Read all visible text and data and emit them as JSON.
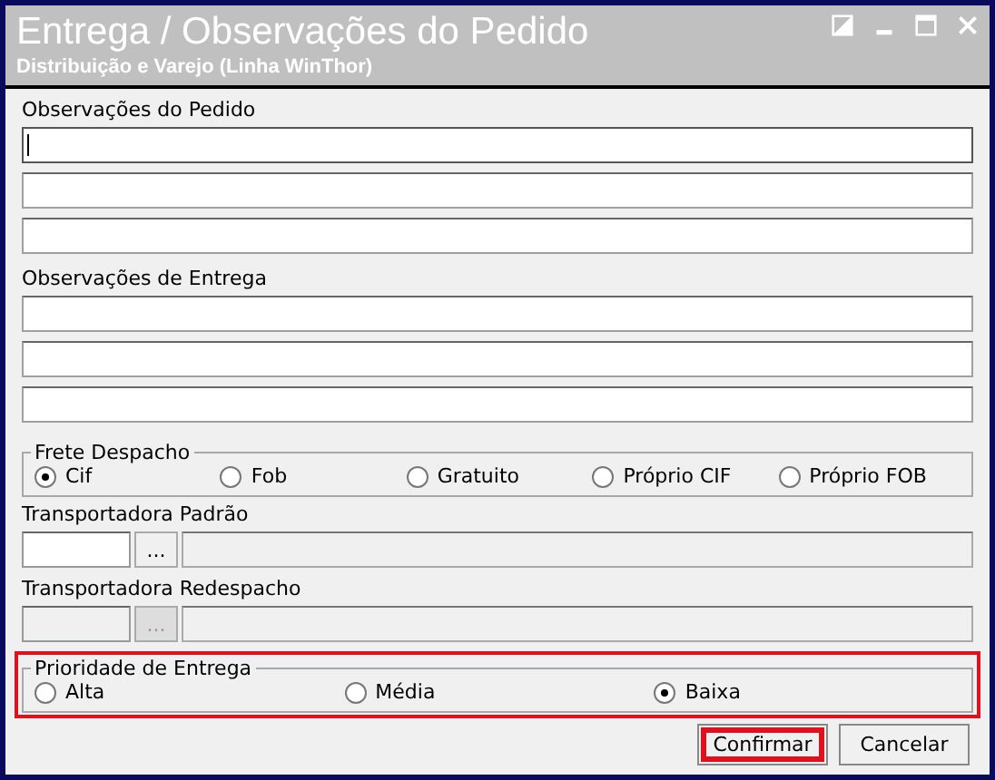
{
  "window": {
    "title": "Entrega / Observações do Pedido",
    "subtitle": "Distribuição e Varejo (Linha WinThor)"
  },
  "order_notes": {
    "label": "Observações do Pedido",
    "lines": [
      {
        "focused": true
      },
      {
        "focused": false
      },
      {
        "focused": false
      }
    ]
  },
  "delivery_notes": {
    "label": "Observações de Entrega",
    "lines": [
      {
        "focused": false
      },
      {
        "focused": false
      },
      {
        "focused": false
      }
    ]
  },
  "freight": {
    "label": "Frete Despacho",
    "highlighted": false,
    "options": [
      {
        "label": "Cif",
        "selected": true
      },
      {
        "label": "Fob",
        "selected": false
      },
      {
        "label": "Gratuito",
        "selected": false
      },
      {
        "label": "Próprio CIF",
        "selected": false
      },
      {
        "label": "Próprio FOB",
        "selected": false
      }
    ]
  },
  "carriers": [
    {
      "label": "Transportadora Padrão",
      "disabled": false,
      "lookup": "..."
    },
    {
      "label": "Transportadora Redespacho",
      "disabled": true,
      "lookup": "..."
    }
  ],
  "priority": {
    "label": "Prioridade de Entrega",
    "highlighted": true,
    "options": [
      {
        "label": "Alta",
        "selected": false
      },
      {
        "label": "Média",
        "selected": false
      },
      {
        "label": "Baixa",
        "selected": true
      }
    ]
  },
  "buttons": [
    {
      "label": "Confirmar",
      "highlighted": true
    },
    {
      "label": "Cancelar",
      "highlighted": false
    }
  ]
}
